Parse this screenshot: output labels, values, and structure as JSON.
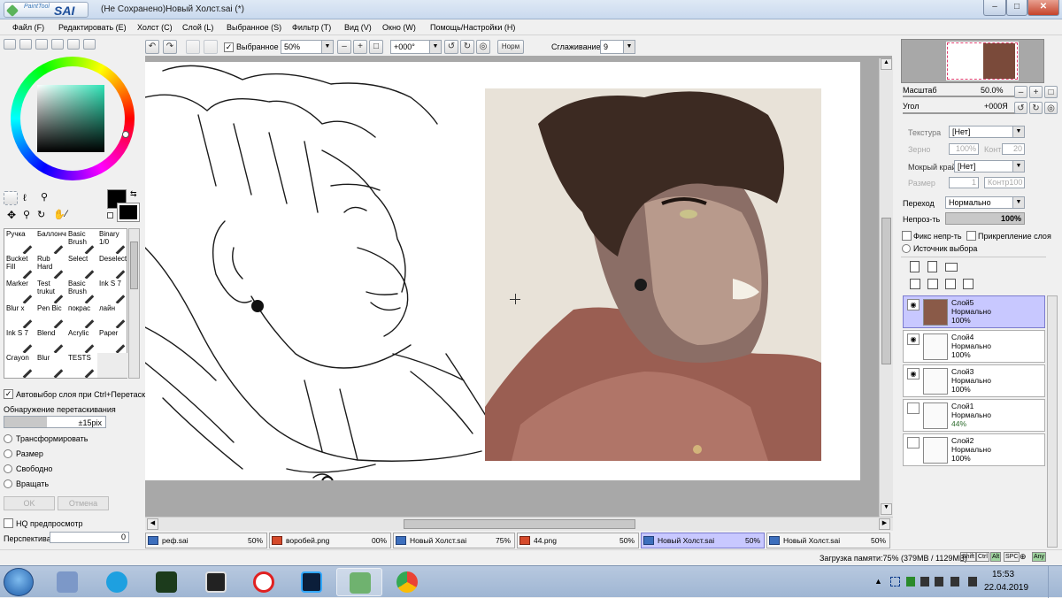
{
  "window": {
    "logo_small": "PaintTool",
    "logo_big": "SAI",
    "title": "(Не Сохранено)Новый Холст.sai (*)",
    "minimize": "–",
    "maximize": "□",
    "close": "✕"
  },
  "menu": [
    "Файл (F)",
    "Редактировать (E)",
    "Холст (C)",
    "Слой (L)",
    "Выбранное (S)",
    "Фильтр (T)",
    "Вид (V)",
    "Окно (W)",
    "Помощь/Настройки (H)"
  ],
  "toolbar": {
    "selection_label": "Выбранное",
    "zoom": "50%",
    "angle": "+000°",
    "norm": "Норм",
    "smoothing_label": "Сглаживание",
    "smoothing": "9"
  },
  "tools": [
    [
      "Ручка",
      "Баллончик",
      "Basic Brush",
      "Binary 1/0"
    ],
    [
      "Bucket Fill",
      "Rub Hard",
      "Select",
      "Deselect"
    ],
    [
      "Marker",
      "Test trukut",
      "Basic Brush",
      "Ink S 7"
    ],
    [
      "Blur x",
      "Pen Bic",
      "покрас",
      "лайн"
    ],
    [
      "Ink S 7",
      "Blend",
      "Acrylic",
      "Paper"
    ],
    [
      "Crayon",
      "Blur",
      "TESTS",
      ""
    ]
  ],
  "left_options": {
    "autoselect": "Автовыбор слоя при Ctrl+Перетаскиван",
    "drag_detect": "Обнаружение перетаскивания",
    "drag_value": "±15pix",
    "transform": "Трансформировать",
    "size": "Размер",
    "free": "Свободно",
    "rotate": "Вращать",
    "ok": "OK",
    "cancel": "Отмена",
    "hq": "HQ предпросмотр",
    "perspective": "Перспектива",
    "perspective_val": "0"
  },
  "navigator": {
    "scale_label": "Масштаб",
    "scale": "50.0%",
    "angle_label": "Угол",
    "angle": "+000Я"
  },
  "brush": {
    "texture_label": "Текстура",
    "texture": "[Нет]",
    "grain_label": "Зерно",
    "grain": "100%",
    "contrast_label": "Контр",
    "contrast": "20",
    "wet_label": "Мокрый край",
    "wet": "[Нет]",
    "size_label": "Размер",
    "size": "1",
    "contrast2": "Контр100"
  },
  "blend": {
    "mode_label": "Переход",
    "mode": "Нормально",
    "opacity_label": "Непроз-ть",
    "opacity": "100%",
    "fix_opacity": "Фикс непр-ть",
    "clip_layer": "Прикрепление слоя",
    "source": "Источник выбора"
  },
  "layers": [
    {
      "name": "Слой5",
      "mode": "Нормально",
      "opacity": "100%"
    },
    {
      "name": "Слой4",
      "mode": "Нормально",
      "opacity": "100%"
    },
    {
      "name": "Слой3",
      "mode": "Нормально",
      "opacity": "100%"
    },
    {
      "name": "Слой1",
      "mode": "Нормально",
      "opacity": "44%"
    },
    {
      "name": "Слой2",
      "mode": "Нормально",
      "opacity": "100%"
    }
  ],
  "tabs": [
    {
      "name": "реф.sai",
      "pct": "50%"
    },
    {
      "name": "воробей.png",
      "pct": "00%"
    },
    {
      "name": "Новый Холст.sai",
      "pct": "75%"
    },
    {
      "name": "44.png",
      "pct": "50%"
    },
    {
      "name": "Новый Холст.sai",
      "pct": "50%"
    },
    {
      "name": "Новый Холст.sai",
      "pct": "50%"
    }
  ],
  "status": {
    "memory": "Загрузка памяти:75% (379MB / 1129MB)",
    "keys": [
      "Shift",
      "Ctrl",
      "Alt",
      "SPC",
      "",
      "Any"
    ]
  },
  "taskbar": {
    "time": "15:53",
    "date": "22.04.2019"
  }
}
